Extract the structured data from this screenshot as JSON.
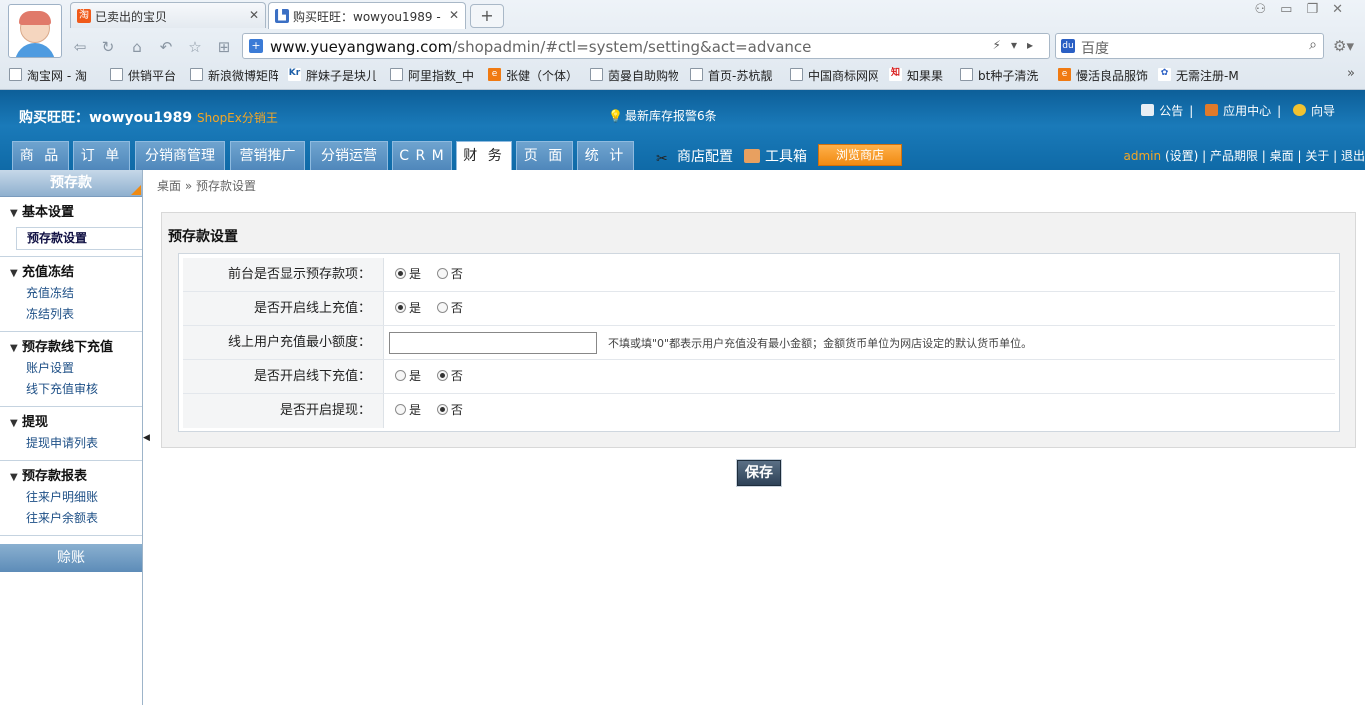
{
  "browser": {
    "tabs": [
      {
        "label": "已卖出的宝贝",
        "icon": "淘"
      },
      {
        "label": "购买旺旺：wowyou1989 -",
        "icon": "▙"
      }
    ],
    "url_host": "www.yueyangwang.com",
    "url_path": "/shopadmin/#ctl=system/setting&act=advance",
    "search_placeholder": "百度",
    "bookmarks": [
      "淘宝网 - 淘",
      "供销平台",
      "新浪微博矩阵",
      "胖妹子是块儿",
      "阿里指数_中",
      "张健（个体）",
      "茵曼自助购物",
      "首页-苏杭靓",
      "中国商标网网",
      "知果果",
      "bt种子清洗",
      "慢活良品服饰",
      "无需注册-M"
    ],
    "bookmark_more": "»"
  },
  "header": {
    "shop_name": "购买旺旺：wowyou1989",
    "shopex": "ShopEx分销王",
    "notice": "最新库存报警6条",
    "links": [
      "公告",
      "应用中心",
      "向导"
    ],
    "tabs": [
      "商 品",
      "订 单",
      "分销商管理",
      "营销推广",
      "分销运营",
      "C R M",
      "财 务",
      "页 面",
      "统 计"
    ],
    "shop_config": "商店配置",
    "toolbox": "工具箱",
    "browse_store": "浏览商店",
    "admin": "admin",
    "admin_links": "(设置) | 产品期限 | 桌面 | 关于 | 退出"
  },
  "sidebar": {
    "title": "预存款",
    "groups": [
      {
        "title": "基本设置",
        "items": [
          "预存款设置"
        ]
      },
      {
        "title": "充值冻结",
        "items": [
          "充值冻结",
          "冻结列表"
        ]
      },
      {
        "title": "预存款线下充值",
        "items": [
          "账户设置",
          "线下充值审核"
        ]
      },
      {
        "title": "提现",
        "items": [
          "提现申请列表"
        ]
      },
      {
        "title": "预存款报表",
        "items": [
          "往来户明细账",
          "往来户余额表"
        ]
      }
    ],
    "bottom": "赊账"
  },
  "main": {
    "breadcrumb": "桌面 » 预存款设置",
    "panel_title": "预存款设置",
    "rows": [
      {
        "label": "前台是否显示预存款项：",
        "yes": "是",
        "no": "否",
        "selected": "yes"
      },
      {
        "label": "是否开启线上充值：",
        "yes": "是",
        "no": "否",
        "selected": "yes"
      },
      {
        "label": "线上用户充值最小额度：",
        "value": "",
        "hint": "不填或填\"0\"都表示用户充值没有最小金额；金额货币单位为网店设定的默认货币单位。"
      },
      {
        "label": "是否开启线下充值：",
        "yes": "是",
        "no": "否",
        "selected": "no"
      },
      {
        "label": "是否开启提现：",
        "yes": "是",
        "no": "否",
        "selected": "no"
      }
    ],
    "save": "保存"
  }
}
